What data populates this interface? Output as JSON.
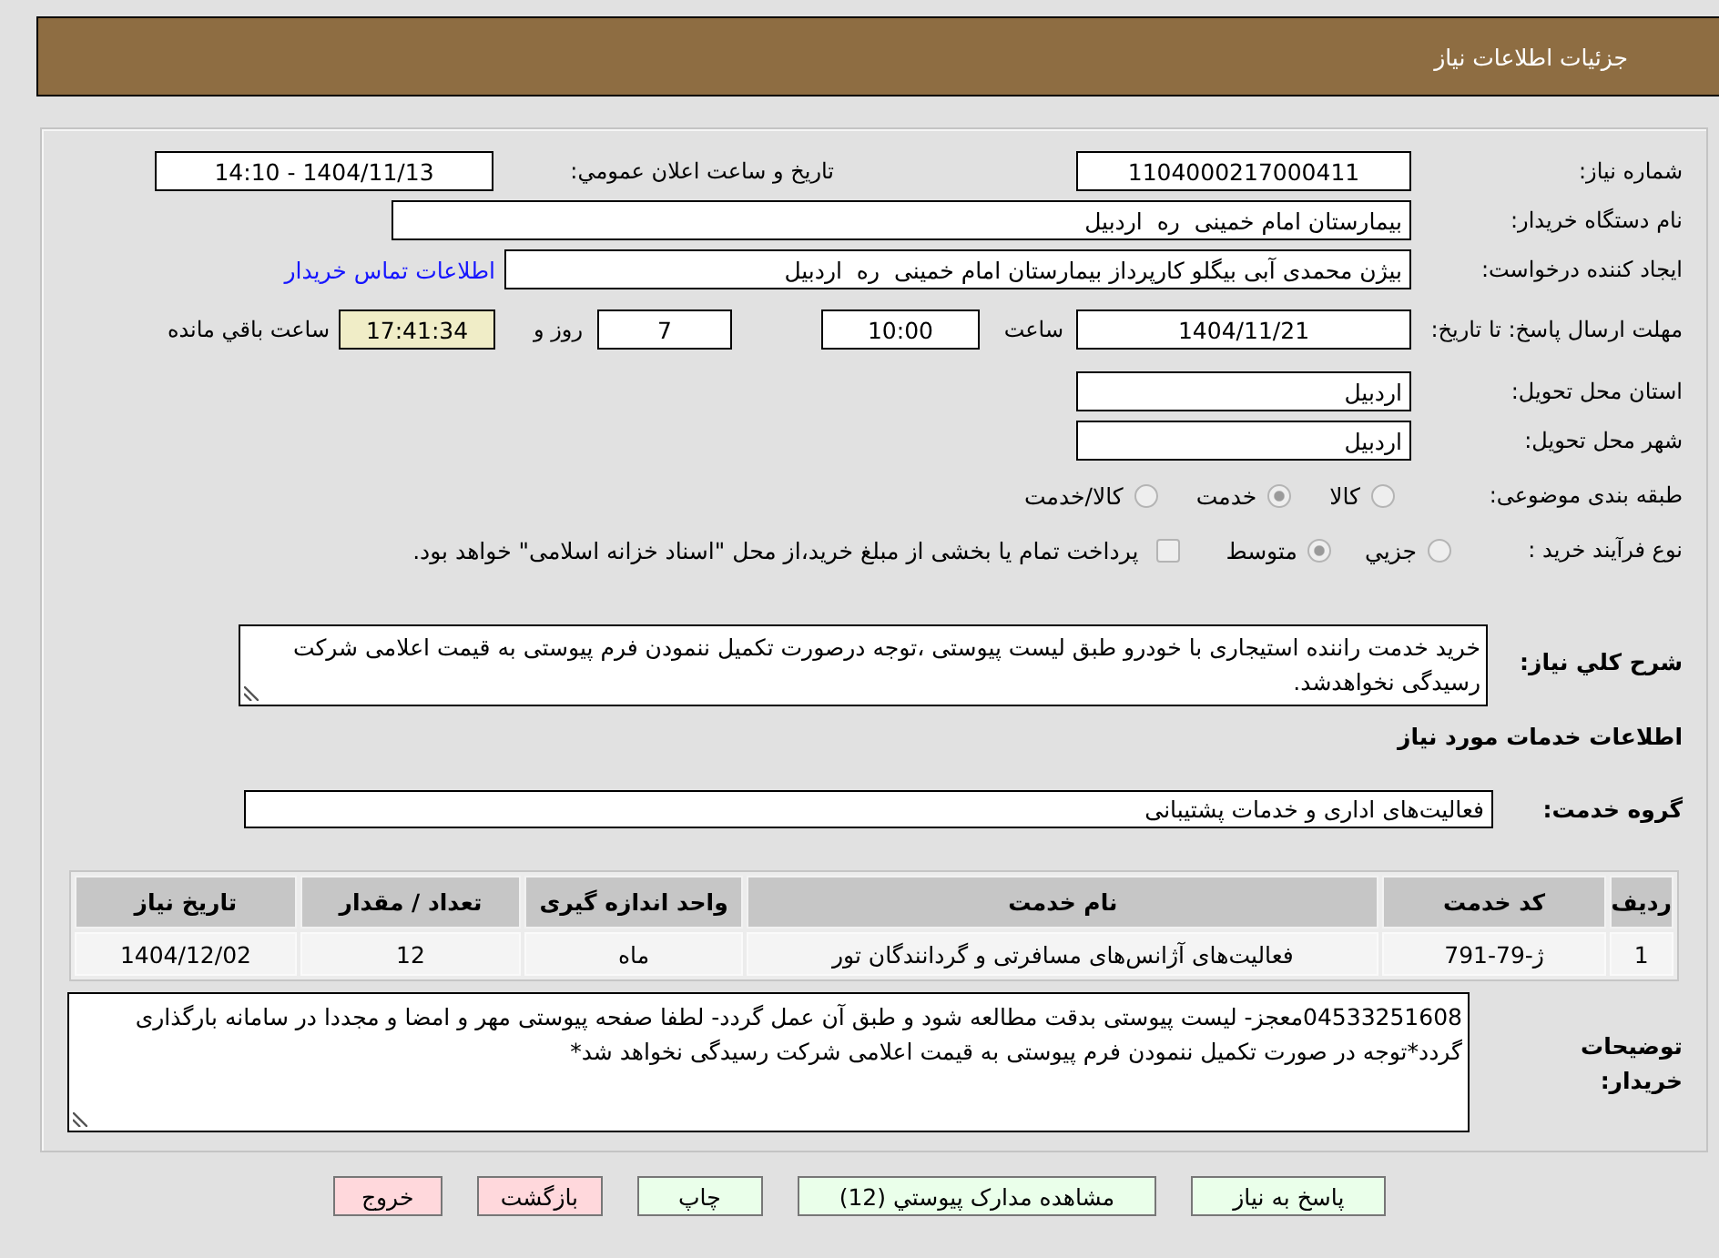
{
  "header": {
    "title": "جزئیات اطلاعات نیاز"
  },
  "need_number": {
    "label": "شماره نیاز:",
    "value": "1104000217000411"
  },
  "announce_datetime": {
    "label": "تاریخ و ساعت اعلان عمومي:",
    "value": "1404/11/13 - 14:10"
  },
  "buyer_org": {
    "label": "نام دستگاه خریدار:",
    "value": "بیمارستان امام خمینی  ره  اردبیل"
  },
  "requester": {
    "label": "ایجاد کننده درخواست:",
    "value": "بیژن محمدی آبی بیگلو کارپرداز بیمارستان امام خمینی  ره  اردبیل",
    "link": "اطلاعات تماس خریدار"
  },
  "deadline": {
    "label": "مهلت ارسال پاسخ: تا تاریخ:",
    "date": "1404/11/21",
    "time_label": "ساعت",
    "time": "10:00",
    "days": "7",
    "days_label": "روز و",
    "remaining": "17:41:34",
    "remaining_label": "ساعت باقي مانده"
  },
  "province": {
    "label": "استان محل تحویل:",
    "value": "اردبیل"
  },
  "city": {
    "label": "شهر محل تحویل:",
    "value": "اردبیل"
  },
  "category": {
    "label": "طبقه بندی موضوعی:",
    "options": [
      {
        "label": "کالا",
        "selected": false
      },
      {
        "label": "خدمت",
        "selected": true
      },
      {
        "label": "کالا/خدمت",
        "selected": false
      }
    ]
  },
  "process_type": {
    "label": "نوع فرآیند خرید :",
    "options": [
      {
        "label": "جزيي",
        "selected": false
      },
      {
        "label": "متوسط",
        "selected": true
      }
    ],
    "treasury": {
      "label": "پرداخت تمام یا بخشی از مبلغ خرید،از محل \"اسناد خزانه اسلامی\" خواهد بود.",
      "checked": false
    }
  },
  "description": {
    "label": "شرح کلي نیاز:",
    "value": "خرید خدمت راننده استیجاری با خودرو طبق لیست پیوستی ،توجه درصورت تکمیل ننمودن فرم پیوستی به قیمت اعلامی شرکت رسیدگی نخواهدشد."
  },
  "services_heading": "اطلاعات خدمات مورد نیاز",
  "service_group": {
    "label": "گروه خدمت:",
    "value": "فعالیت‌های اداری و خدمات پشتیبانی"
  },
  "table": {
    "columns": [
      "ردیف",
      "کد خدمت",
      "نام خدمت",
      "واحد اندازه گیری",
      "تعداد / مقدار",
      "تاریخ نیاز"
    ],
    "rows": [
      [
        "1",
        "ژ-79-791",
        "فعالیت‌های آژانس‌های مسافرتی و گردانندگان تور",
        "ماه",
        "12",
        "1404/12/02"
      ]
    ]
  },
  "buyer_notes": {
    "label": "توضیحات خریدار:",
    "value": "04533251608معجز- لیست پیوستی بدقت مطالعه شود و طبق آن عمل گردد- لطفا صفحه پیوستی مهر و امضا و مجددا در سامانه بارگذاری گردد*توجه در صورت تکمیل ننمودن فرم پیوستی به قیمت اعلامی شرکت رسیدگی نخواهد شد*"
  },
  "buttons": [
    {
      "label": "پاسخ به نیاز",
      "kind": "action"
    },
    {
      "label": "مشاهده مدارک پیوستي (12)",
      "kind": "action"
    },
    {
      "label": "چاپ",
      "kind": "action"
    },
    {
      "label": "بازگشت",
      "kind": "exit"
    },
    {
      "label": "خروج",
      "kind": "exit"
    }
  ]
}
